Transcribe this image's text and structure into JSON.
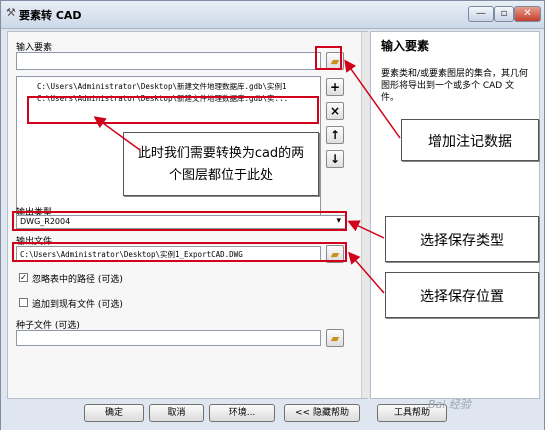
{
  "window": {
    "title": "要素转 CAD",
    "min_glyph": "—",
    "max_glyph": "▫",
    "close_glyph": "✕"
  },
  "input": {
    "label": "输入要素",
    "rows": [
      "C:\\Users\\Administrator\\Desktop\\新建文件地理数据库.gdb\\实例1",
      "C:\\Users\\Administrator\\Desktop\\新建文件地理数据库.gdb\\实..."
    ],
    "add_glyph": "+",
    "remove_glyph": "×",
    "up_glyph": "↑",
    "down_glyph": "↓"
  },
  "output_type": {
    "label": "输出类型",
    "value": "DWG_R2004",
    "arrow_glyph": "▾"
  },
  "output_file": {
    "label": "输出文件",
    "value": "C:\\Users\\Administrator\\Desktop\\实例1_ExportCAD.DWG"
  },
  "options": {
    "ignore_paths_label": "忽略表中的路径 (可选)",
    "ignore_paths_checked": true,
    "check_glyph": "✓",
    "append_label": "追加到现有文件 (可选)",
    "append_checked": false,
    "seed_label": "种子文件 (可选)",
    "seed_value": ""
  },
  "help": {
    "title": "输入要素",
    "text": "要素类和/或要素图层的集合，其几何图形将导出到一个或多个 CAD 文件。"
  },
  "buttons": {
    "ok": "确定",
    "cancel": "取消",
    "environments": "环境...",
    "hide_help": "<< 隐藏帮助",
    "tool_help": "工具帮助"
  },
  "callouts": {
    "layers": "此时我们需要转换为cad的两个图层都位于此处",
    "add_annotation": "增加注记数据",
    "save_type": "选择保存类型",
    "save_location": "选择保存位置"
  },
  "watermark": "Bai 经验",
  "icons": {
    "title": "tool-hammer-icon",
    "folder": "folder-open-icon",
    "add": "plus-icon",
    "remove": "cross-icon",
    "up": "arrow-up-icon",
    "down": "arrow-down-icon",
    "dropdown": "chevron-down-icon",
    "check": "check-icon"
  },
  "colors": {
    "highlight": "#d0021b",
    "window_bg": "#dfe6f0",
    "folder": "#c7911d"
  }
}
